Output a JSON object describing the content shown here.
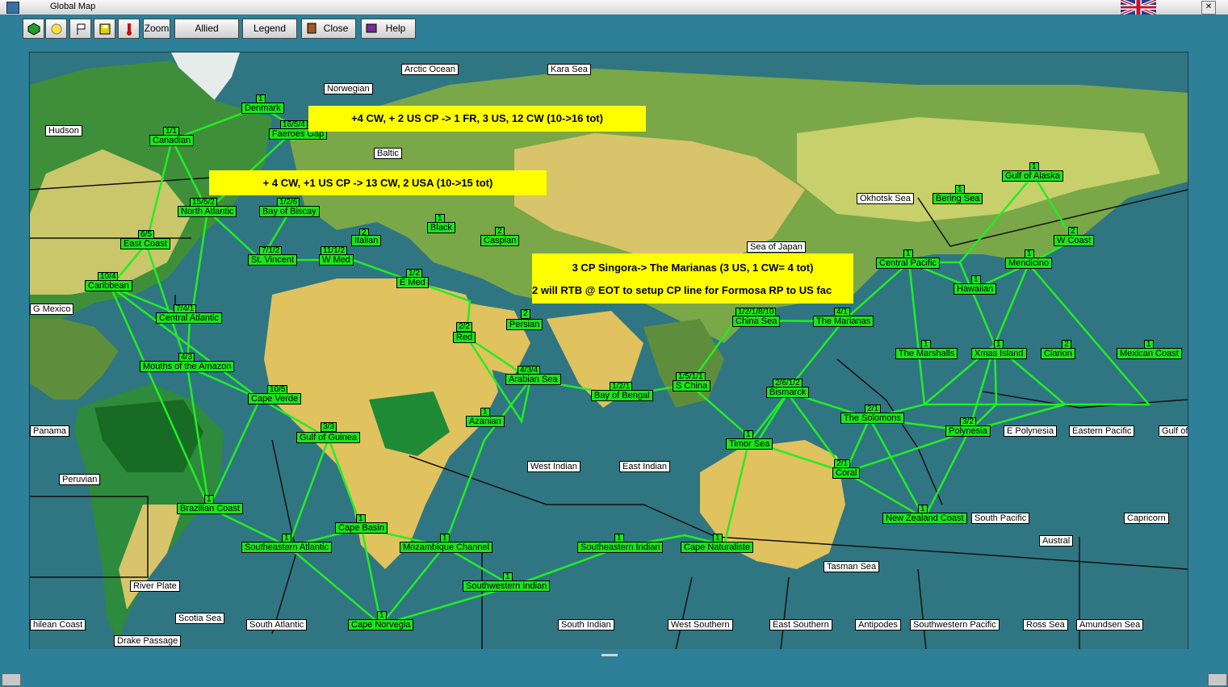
{
  "window": {
    "title": "Global Map"
  },
  "toolbar": {
    "zoom": "Zoom",
    "allied_convoys": "Allied Convoys",
    "legend": "Legend",
    "close": "Close",
    "help": "Help"
  },
  "notes": {
    "n1": "+4 CW, + 2 US CP -> 1 FR, 3 US, 12 CW (10->16 tot)",
    "n2": "+ 4 CW, +1 US CP -> 13 CW, 2 USA (10->15 tot)",
    "n3a": "3 CP Singora-> The Marianas (3 US, 1 CW= 4 tot)",
    "n3b": "2 will RTB @ EOT to setup CP line for Formosa RP to US fac"
  },
  "seas": {
    "arctic": "Arctic Ocean",
    "kara": "Kara Sea",
    "norwegian": "Norwegian",
    "hudson": "Hudson",
    "baltic": "Baltic",
    "okhotsk": "Okhotsk Sea",
    "japan": "Sea of Japan",
    "mexico": "G Mexico",
    "panama": "Panama",
    "peruvian": "Peruvian",
    "westindian": "West Indian",
    "eastindian": "East Indian",
    "epoly": "E Polynesia",
    "epacific": "Eastern Pacific",
    "gulfof": "Gulf of",
    "spacific": "South Pacific",
    "capricorn": "Capricorn",
    "austral": "Austral",
    "tasman": "Tasman Sea",
    "riverplate": "River Plate",
    "scotia": "Scotia Sea",
    "chilean": "hilean Coast",
    "satlantic": "South Atlantic",
    "drake": "Drake Passage",
    "sindian": "South Indian",
    "wsouthern": "West Southern",
    "esouthern": "East Southern",
    "antipodes": "Antipodes",
    "swpacific": "Southwestern Pacific",
    "ross": "Ross Sea",
    "amundsen": "Amundsen Sea"
  },
  "zones": {
    "denmark": "Denmark",
    "faeroes": "Faeroes Gap",
    "canadian": "Canadian",
    "natlantic": "North Atlantic",
    "biscay": "Bay of Biscay",
    "black": "Black",
    "italian": "Italian",
    "caspian": "Caspian",
    "eastcoast": "East Coast",
    "stvincent": "St. Vincent",
    "wmed": "W Med",
    "emed": "E Med",
    "caribbean": "Caribbean",
    "catlantic": "Central Atlantic",
    "amazon": "Mouths of the Amazon",
    "red": "Red",
    "persian": "Persian",
    "arabian": "Arabian Sea",
    "bengal": "Bay of Bengal",
    "capeverde": "Cape Verde",
    "guinea": "Gulf of Guinea",
    "azanian": "Azanian",
    "brazilian": "Brazilian Coast",
    "capebasin": "Cape Basin",
    "seatlantic": "Southeastern Atlantic",
    "mozambique": "Mozambique Channel",
    "seindian": "Southeastern Indian",
    "capenat": "Cape Naturaliste",
    "swindian": "Southwestern Indian",
    "capenorvegia": "Cape Norvegia",
    "chinasea": "China Sea",
    "marianas": "The Marianas",
    "schina": "S China",
    "bismarck": "Bismarck",
    "timor": "Timor Sea",
    "solomons": "The Solomons",
    "coral": "Coral",
    "nzcoast": "New Zealand Coast",
    "polynesia": "Polynesia",
    "marshalls": "The Marshalls",
    "xmas": "Xmas Island",
    "clarion": "Clarion",
    "mexicancoast": "Mexican Coast",
    "centralpacific": "Central Pacific",
    "hawaiian": "Hawaiian",
    "mendicino": "Mendicino",
    "wcoast": "W Coast",
    "bering": "Bering Sea",
    "alaska": "Gulf of Alaska"
  },
  "counts": {
    "denmark": "1",
    "faeroes": "16/5/4",
    "canadian": "1/1",
    "natlantic": "15/5/2",
    "biscay": "1/2/6",
    "black": "1",
    "italian": "2",
    "caspian": "2",
    "eastcoast": "6/5",
    "stvincent": "7/1/2",
    "wmed": "11/1/2",
    "emed": "1/2",
    "caribbean": "10/4",
    "catlantic": "7/4/1",
    "amazon": "4/3",
    "red": "2/2",
    "persian": "2",
    "arabian": "4/3/4",
    "bengal": "1/2/1",
    "capeverde": "10/5",
    "guinea": "3/3",
    "azanian": "1",
    "brazilian": "1",
    "capebasin": "1",
    "seatlantic": "1",
    "mozambique": "1",
    "seindian": "1",
    "capenat": "1",
    "swindian": "1",
    "capenorvegia": "1",
    "chinasea": "1/2/1/8/10",
    "marianas": "4/1",
    "schina": "1/5/1/1",
    "bismarck": "2/6/1/2",
    "timor": "1",
    "solomons": "2/1",
    "coral": "2/1",
    "nzcoast": "1",
    "polynesia": "3/2",
    "marshalls": "1",
    "xmas": "1",
    "clarion": "2",
    "mexicancoast": "1",
    "centralpacific": "1",
    "hawaiian": "1",
    "mendicino": "1",
    "wcoast": "2",
    "bering": "1",
    "alaska": "1"
  }
}
